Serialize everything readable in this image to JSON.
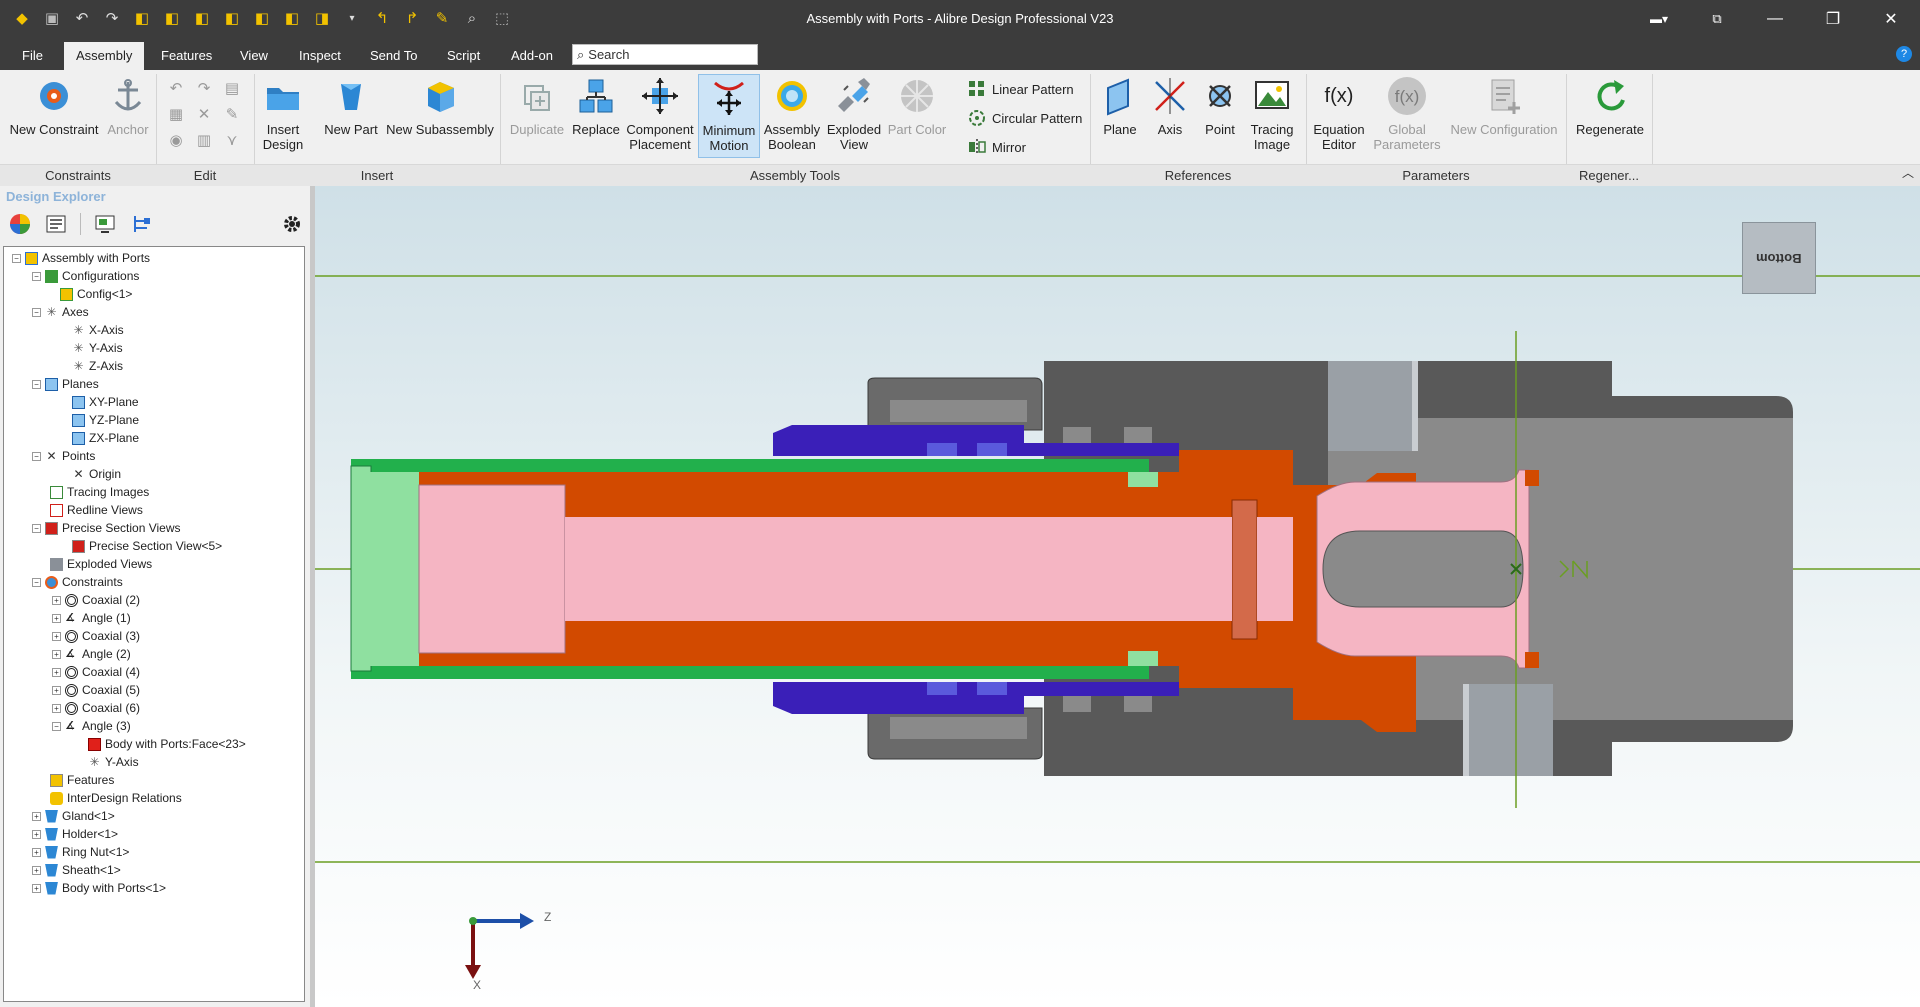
{
  "window": {
    "title": "Assembly with Ports - Alibre Design Professional V23"
  },
  "menu": {
    "tabs": [
      "File",
      "Assembly",
      "Features",
      "View",
      "Inspect",
      "Send To",
      "Script",
      "Add-on"
    ],
    "active": "Assembly",
    "search_placeholder": "Search"
  },
  "ribbon": {
    "new_constraint": "New Constraint",
    "anchor": "Anchor",
    "insert_design": [
      "Insert",
      "Design"
    ],
    "new_part": "New Part",
    "new_subassembly": "New Subassembly",
    "duplicate": "Duplicate",
    "replace": "Replace",
    "component_placement": [
      "Component",
      "Placement"
    ],
    "minimum_motion": [
      "Minimum",
      "Motion"
    ],
    "assembly_boolean": [
      "Assembly",
      "Boolean"
    ],
    "exploded_view": [
      "Exploded",
      "View"
    ],
    "part_color": "Part Color",
    "linear_pattern": "Linear Pattern",
    "circular_pattern": "Circular Pattern",
    "mirror": "Mirror",
    "plane": "Plane",
    "axis": "Axis",
    "point": "Point",
    "tracing_image": [
      "Tracing",
      "Image"
    ],
    "equation_editor": [
      "Equation",
      "Editor"
    ],
    "global_parameters": [
      "Global",
      "Parameters"
    ],
    "new_configuration": "New Configuration",
    "regenerate": "Regenerate",
    "fx": "f(x)",
    "groups": {
      "constraints": "Constraints",
      "edit": "Edit",
      "insert": "Insert",
      "assembly_tools": "Assembly Tools",
      "references": "References",
      "parameters": "Parameters",
      "regen": "Regener..."
    }
  },
  "explorer": {
    "title": "Design Explorer",
    "tree": [
      {
        "label": "Assembly with Ports",
        "icon": "assembly-icon"
      },
      {
        "label": "Configurations",
        "icon": "configurations-icon"
      },
      {
        "label": "Config<1>",
        "icon": "config-icon"
      },
      {
        "label": "Axes",
        "icon": "axes-icon"
      },
      {
        "label": "X-Axis",
        "icon": "axis-icon"
      },
      {
        "label": "Y-Axis",
        "icon": "axis-icon"
      },
      {
        "label": "Z-Axis",
        "icon": "axis-icon"
      },
      {
        "label": "Planes",
        "icon": "planes-icon"
      },
      {
        "label": "XY-Plane",
        "icon": "plane-icon"
      },
      {
        "label": "YZ-Plane",
        "icon": "plane-icon"
      },
      {
        "label": "ZX-Plane",
        "icon": "plane-icon"
      },
      {
        "label": "Points",
        "icon": "points-icon"
      },
      {
        "label": "Origin",
        "icon": "point-icon"
      },
      {
        "label": "Tracing Images",
        "icon": "tracing-images-icon"
      },
      {
        "label": "Redline Views",
        "icon": "redline-views-icon"
      },
      {
        "label": "Precise Section Views",
        "icon": "section-views-icon"
      },
      {
        "label": "Precise Section View<5>",
        "icon": "section-view-icon"
      },
      {
        "label": "Exploded Views",
        "icon": "exploded-views-icon"
      },
      {
        "label": "Constraints",
        "icon": "constraints-icon"
      },
      {
        "label": "Coaxial (2)",
        "icon": "coaxial-icon"
      },
      {
        "label": "Angle (1)",
        "icon": "angle-icon"
      },
      {
        "label": "Coaxial (3)",
        "icon": "coaxial-icon"
      },
      {
        "label": "Angle (2)",
        "icon": "angle-icon"
      },
      {
        "label": "Coaxial (4)",
        "icon": "coaxial-icon"
      },
      {
        "label": "Coaxial (5)",
        "icon": "coaxial-icon"
      },
      {
        "label": "Coaxial (6)",
        "icon": "coaxial-icon"
      },
      {
        "label": "Angle (3)",
        "icon": "angle-icon"
      },
      {
        "label": "Body with Ports:Face<23>",
        "icon": "face-icon"
      },
      {
        "label": "Y-Axis",
        "icon": "axis-icon"
      },
      {
        "label": "Features",
        "icon": "features-icon"
      },
      {
        "label": "InterDesign Relations",
        "icon": "relations-icon"
      },
      {
        "label": "Gland<1>",
        "icon": "part-icon"
      },
      {
        "label": "Holder<1>",
        "icon": "part-icon"
      },
      {
        "label": "Ring Nut<1>",
        "icon": "part-icon"
      },
      {
        "label": "Sheath<1>",
        "icon": "part-icon"
      },
      {
        "label": "Body with Ports<1>",
        "icon": "part-icon"
      }
    ]
  },
  "viewport": {
    "view_cube_label": "Bottom",
    "triad_z": "Z",
    "triad_x": "X",
    "colors": {
      "body": "#595959",
      "body_inner": "#8a8a8a",
      "holder": "#d24a00",
      "sheath": "#22b04c",
      "ring_nut": "#3a1fb8",
      "gland": "#f5b5c3",
      "guide_line": "#6b9e23"
    }
  }
}
